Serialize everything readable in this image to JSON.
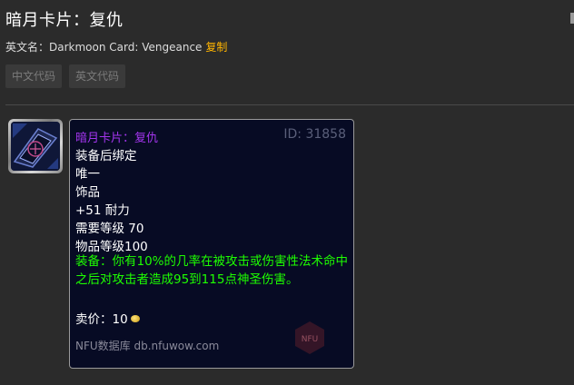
{
  "header": {
    "title": "暗月卡片：复仇",
    "en_label": "英文名：",
    "en_name": "Darkmoon Card: Vengeance",
    "copy_label": "复制"
  },
  "buttons": {
    "cn_code": "中文代码",
    "en_code": "英文代码"
  },
  "item": {
    "icon": "darkmoon-card-icon",
    "name": "暗月卡片：复仇",
    "name_color": "#a335ee",
    "id_text": "ID: 31858",
    "bind": "装备后绑定",
    "unique": "唯一",
    "slot": "饰品",
    "stat": "+51 耐力",
    "req_level": "需要等级 70",
    "item_level": "物品等级100",
    "equip_text": "装备：你有10%的几率在被攻击或伤害性法术命中之后对攻击者造成95到115点神圣伤害。",
    "sell_label": "卖价：",
    "sell_value": "10",
    "footer": "NFU数据库 db.nfuwow.com",
    "watermark": "NFU"
  },
  "colors": {
    "accent_copy": "#ffb400",
    "equip_green": "#1eff00",
    "tooltip_bg": "#070b24"
  }
}
